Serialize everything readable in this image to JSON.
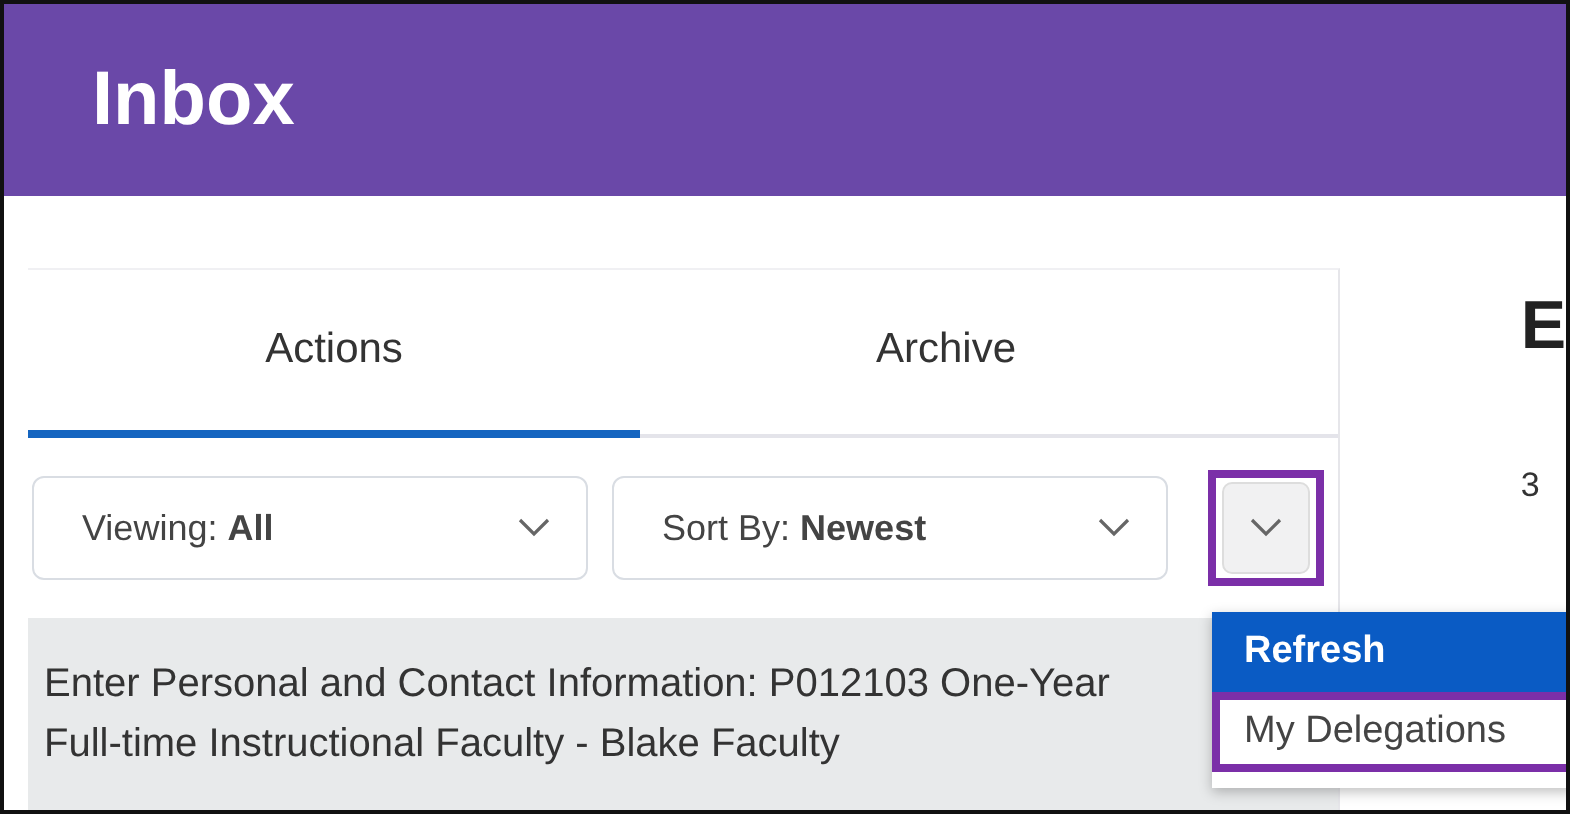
{
  "header": {
    "title": "Inbox"
  },
  "tabs": [
    {
      "label": "Actions",
      "selected": true
    },
    {
      "label": "Archive",
      "selected": false
    }
  ],
  "filters": [
    {
      "label": "Viewing:",
      "value": "All"
    },
    {
      "label": "Sort By:",
      "value": "Newest"
    }
  ],
  "more_button": {
    "highlighted": true
  },
  "menu": [
    {
      "label": "Refresh",
      "selected": true,
      "highlighted": false
    },
    {
      "label": "My Delegations",
      "selected": false,
      "highlighted": true
    }
  ],
  "items": [
    {
      "title": "Enter Personal and Contact Information: P012103 One-Year Full-time Instructional Faculty - Blake Faculty"
    }
  ],
  "detail": {
    "title": "E",
    "text": "3"
  }
}
